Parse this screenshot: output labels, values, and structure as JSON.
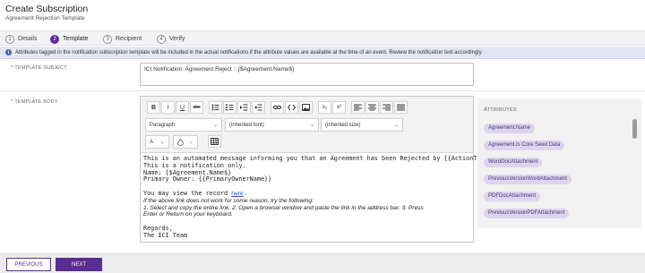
{
  "header": {
    "title": "Create Subscription",
    "subtitle": "Agreement Rejection Template"
  },
  "steps": [
    {
      "num": "1",
      "label": "Details"
    },
    {
      "num": "2",
      "label": "Template"
    },
    {
      "num": "3",
      "label": "Recipient"
    },
    {
      "num": "4",
      "label": "Verify"
    }
  ],
  "info": {
    "icon": "info-icon",
    "text": "Attributes tagged in the notification subscription template will be included in the actual notifications if the attribute values are available at the time of an event. Review the notification text accordingly."
  },
  "subject": {
    "label": "TEMPLATE SUBJECT",
    "value": "ICI Notification: Agreement Reject :: {$Agreement.Name$}"
  },
  "body": {
    "label": "TEMPLATE BODY",
    "toolbar": {
      "bold": "B",
      "italic": "I",
      "underline": "U",
      "strike": "abc",
      "subscript": "x₂",
      "superscript": "x²",
      "paragraph": "Paragraph",
      "font": "(inherited font)",
      "size": "(inherited size)",
      "text_color": "A"
    },
    "lines": [
      "This is an automated message informing you that an Agreement has been Rejected by {{ActionTakerName}}",
      "This is a notification only.",
      "Name: {$Agreement.Name$}",
      "Primary Owner: {{PrimaryOwnerName}}",
      "",
      "You may view the record ",
      "here",
      ".",
      "If the above link does not work for some reason, try the following:",
      "1. Select and copy the entire link. 2. Open a browser window and paste the link in the address bar. 3. Press",
      "Enter or Return on your keyboard.",
      "",
      "Regards,",
      "The ICI Team"
    ]
  },
  "attributes": {
    "title": "ATTRIBUTES",
    "items": [
      "Agreement.Name",
      "Agreement.Is Core Seed Data",
      "WordDocAttachment",
      "PreviousVersionWordAttachment",
      "PDFDocAttachment",
      "PreviousVersionPDFAttachment"
    ]
  },
  "footer": {
    "previous": "PREVIOUS",
    "next": "NEXT"
  },
  "colors": {
    "accent": "#5a2d91",
    "chip": "#ddd4ef",
    "info_bg": "#e4e7f3"
  }
}
